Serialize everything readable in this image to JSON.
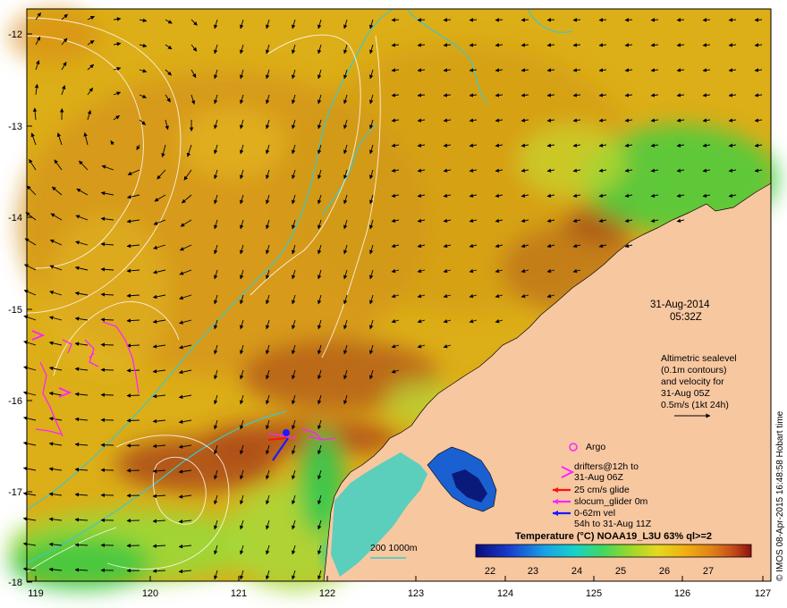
{
  "map": {
    "lon_ticks": [
      "119",
      "120",
      "121",
      "122",
      "123",
      "124",
      "125",
      "126",
      "127"
    ],
    "lat_ticks": [
      "-12",
      "-13",
      "-14",
      "-15",
      "-16",
      "-17",
      "-18"
    ],
    "date": "31-Aug-2014",
    "time": "05:32Z",
    "altimetry_note": [
      "Altimetric sealevel",
      "(0.1m contours)",
      "and velocity for",
      "31-Aug 05Z",
      "0.5m/s (1kt 24h)"
    ],
    "legend": {
      "argo": "Argo",
      "drifters": [
        "drifters@12h to",
        "31-Aug 06Z"
      ],
      "glide": "25 cm/s glide",
      "glider": "slocum_glider 0m",
      "vel": [
        "0-62m vel",
        "54h to 31-Aug 11Z"
      ]
    },
    "bathymetry_label": "200  1000m",
    "colorbar": {
      "title": "Temperature (°C) NOAA19_L3U 63% ql>=2",
      "ticks": [
        "22",
        "23",
        "24",
        "25",
        "26",
        "27"
      ]
    },
    "credit": "© IMOS 08-Apr-2015 16:48:58 Hobart time",
    "colors": {
      "land": "#f7c7a0",
      "warm": "#d9a210",
      "hot": "#b4501e",
      "mid": "#e3c02a",
      "green": "#6fd24a",
      "cyan": "#00c8c8",
      "blue": "#0a2aa0",
      "contour_white": "#ffffff",
      "drifter_magenta": "#ff22ff",
      "glide_red": "#ff1010",
      "vel_blue": "#1a1aff",
      "isobath": "#3cc8c8"
    }
  }
}
